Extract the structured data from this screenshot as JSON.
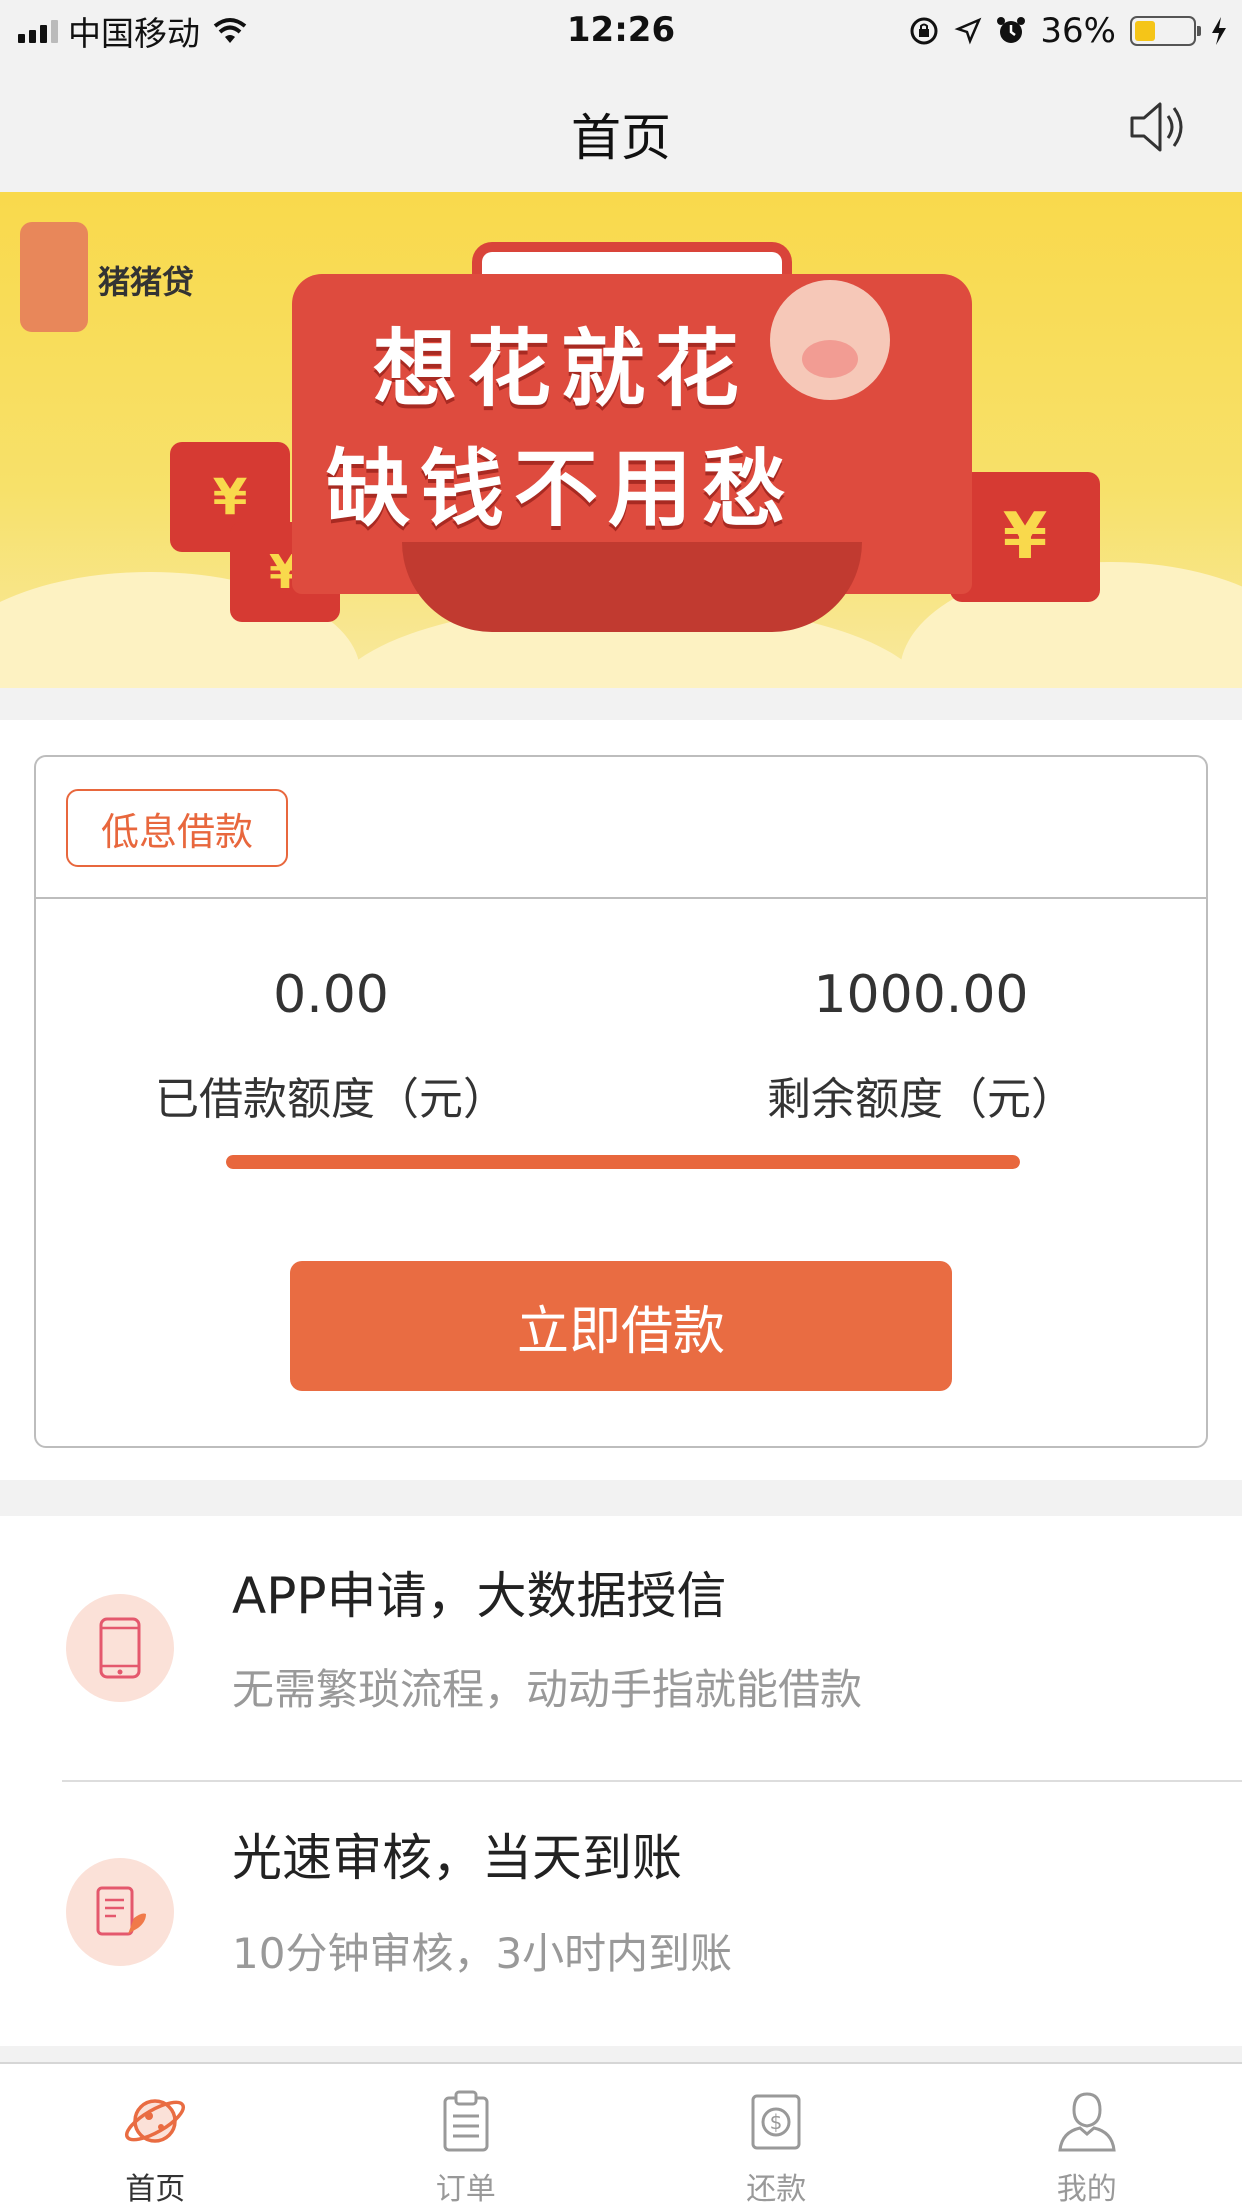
{
  "status_bar": {
    "carrier": "中国移动",
    "time": "12:26",
    "battery": "36%",
    "battery_level": 0.36
  },
  "nav": {
    "title": "首页"
  },
  "banner": {
    "logo_text": "猪猪贷",
    "line1": "想花就花",
    "line2": "缺钱不用愁"
  },
  "loan_card": {
    "tag": "低息借款",
    "borrowed_value": "0.00",
    "borrowed_label": "已借款额度（元）",
    "remaining_value": "1000.00",
    "remaining_label": "剩余额度（元）",
    "remaining_ratio": 1.0,
    "borrow_button": "立即借款"
  },
  "features": [
    {
      "title": "APP申请，大数据授信",
      "desc": "无需繁琐流程，动动手指就能借款",
      "icon": "phone-icon"
    },
    {
      "title": "光速审核，当天到账",
      "desc": "10分钟审核，3小时内到账",
      "icon": "document-rocket-icon"
    }
  ],
  "tabs": [
    {
      "label": "首页",
      "icon": "planet-icon",
      "active": true
    },
    {
      "label": "订单",
      "icon": "clipboard-icon",
      "active": false
    },
    {
      "label": "还款",
      "icon": "money-cycle-icon",
      "active": false
    },
    {
      "label": "我的",
      "icon": "user-icon",
      "active": false
    }
  ],
  "colors": {
    "accent": "#e96c42",
    "banner_yellow": "#f9d94c",
    "banner_red": "#de4b3e"
  }
}
